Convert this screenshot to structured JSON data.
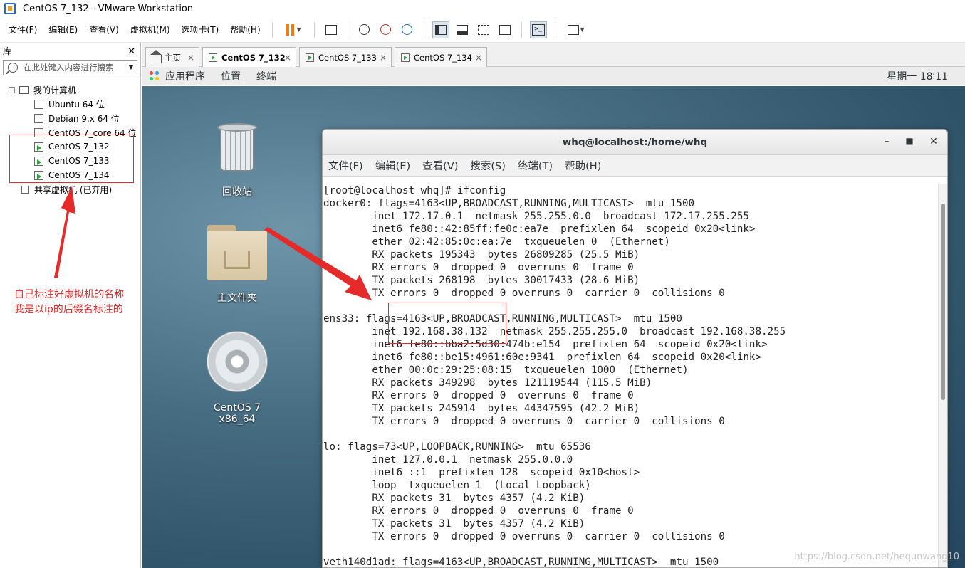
{
  "window": {
    "title": "CentOS 7_132 - VMware Workstation"
  },
  "menubar": {
    "items": [
      "文件(F)",
      "编辑(E)",
      "查看(V)",
      "虚拟机(M)",
      "选项卡(T)",
      "帮助(H)"
    ]
  },
  "toolbar": {
    "icons": [
      "pause-icon",
      "send-ctrl-alt-del-icon",
      "snapshot-icon",
      "revert-snapshot-icon",
      "snapshot-manager-icon",
      "library-view-icon",
      "thumbnail-view-icon",
      "fullscreen-icon",
      "unity-icon",
      "console-icon",
      "stretch-icon"
    ]
  },
  "library": {
    "title": "库",
    "close": "×",
    "search_placeholder": "在此处键入内容进行搜索",
    "root": "我的计算机",
    "vms": [
      "Ubuntu 64 位",
      "Debian 9.x 64 位",
      "CentOS 7_core 64 位",
      "CentOS 7_132",
      "CentOS 7_133",
      "CentOS 7_134"
    ],
    "shared": "共享虚拟机 (已弃用)"
  },
  "annotation": {
    "line1": "自己标注好虚拟机的名称",
    "line2": "我是以ip的后缀名标注的"
  },
  "tabs": [
    {
      "label": "主页",
      "active": false
    },
    {
      "label": "CentOS 7_132",
      "active": true
    },
    {
      "label": "CentOS 7_133",
      "active": false
    },
    {
      "label": "CentOS 7_134",
      "active": false
    }
  ],
  "gnome": {
    "apps": "应用程序",
    "places": "位置",
    "terminal": "终端",
    "clock": "星期一 18∶11"
  },
  "desktop": {
    "icons": [
      "回收站",
      "主文件夹",
      "CentOS 7 x86_64"
    ]
  },
  "terminal": {
    "title": "whq@localhost:/home/whq",
    "menu": [
      "文件(F)",
      "编辑(E)",
      "查看(V)",
      "搜索(S)",
      "终端(T)",
      "帮助(H)"
    ],
    "lines": [
      "[root@localhost whq]# ifconfig",
      "docker0: flags=4163<UP,BROADCAST,RUNNING,MULTICAST>  mtu 1500",
      "        inet 172.17.0.1  netmask 255.255.0.0  broadcast 172.17.255.255",
      "        inet6 fe80::42:85ff:fe0c:ea7e  prefixlen 64  scopeid 0x20<link>",
      "        ether 02:42:85:0c:ea:7e  txqueuelen 0  (Ethernet)",
      "        RX packets 195343  bytes 26809285 (25.5 MiB)",
      "        RX errors 0  dropped 0  overruns 0  frame 0",
      "        TX packets 268198  bytes 30017433 (28.6 MiB)",
      "        TX errors 0  dropped 0 overruns 0  carrier 0  collisions 0",
      "",
      "ens33: flags=4163<UP,BROADCAST,RUNNING,MULTICAST>  mtu 1500",
      "        inet 192.168.38.132  netmask 255.255.255.0  broadcast 192.168.38.255",
      "        inet6 fe80::bba2:5d30:474b:e154  prefixlen 64  scopeid 0x20<link>",
      "        inet6 fe80::be15:4961:60e:9341  prefixlen 64  scopeid 0x20<link>",
      "        ether 00:0c:29:25:08:15  txqueuelen 1000  (Ethernet)",
      "        RX packets 349298  bytes 121119544 (115.5 MiB)",
      "        RX errors 0  dropped 0  overruns 0  frame 0",
      "        TX packets 245914  bytes 44347595 (42.2 MiB)",
      "        TX errors 0  dropped 0 overruns 0  carrier 0  collisions 0",
      "",
      "lo: flags=73<UP,LOOPBACK,RUNNING>  mtu 65536",
      "        inet 127.0.0.1  netmask 255.0.0.0",
      "        inet6 ::1  prefixlen 128  scopeid 0x10<host>",
      "        loop  txqueuelen 1  (Local Loopback)",
      "        RX packets 31  bytes 4357 (4.2 KiB)",
      "        RX errors 0  dropped 0  overruns 0  frame 0",
      "        TX packets 31  bytes 4357 (4.2 KiB)",
      "        TX errors 0  dropped 0 overruns 0  carrier 0  collisions 0",
      "",
      "veth140d1ad: flags=4163<UP,BROADCAST,RUNNING,MULTICAST>  mtu 1500"
    ]
  },
  "watermark": "https://blog.csdn.net/hequnwang10",
  "colors": {
    "annotation": "#e52a2a",
    "pause": "#f07d12",
    "running": "#2ba33b"
  }
}
